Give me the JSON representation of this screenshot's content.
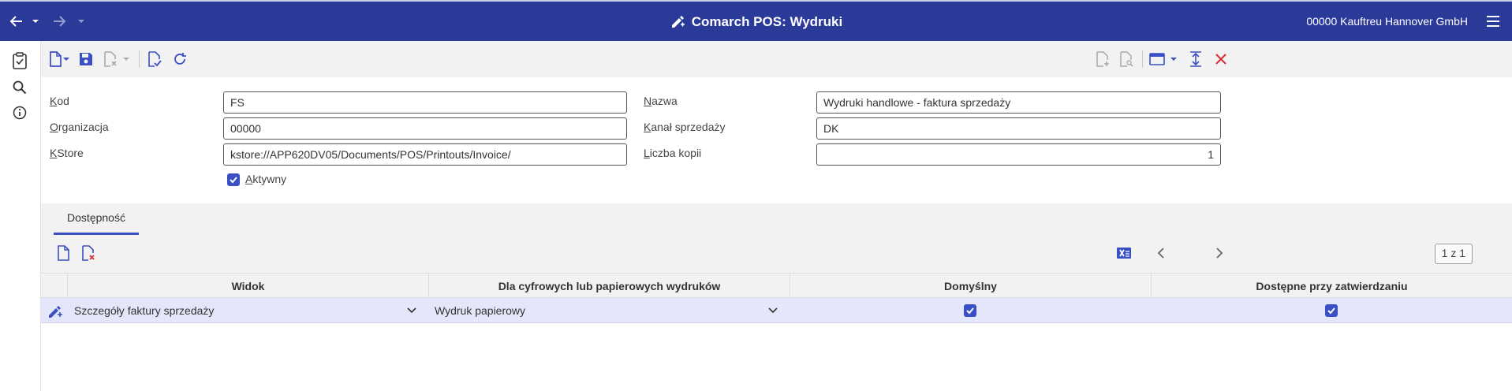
{
  "app": {
    "title": "Comarch POS: Wydruki",
    "company": "00000  Kauftreu Hannover GmbH",
    "icons": {
      "back": "arrow-left-icon",
      "forward": "arrow-right-icon",
      "title": "edit-pencil-icon",
      "menu": "hamburger-menu-icon"
    }
  },
  "rail": [
    {
      "name": "clipboard-check-icon"
    },
    {
      "name": "search-icon"
    },
    {
      "name": "info-icon"
    }
  ],
  "form": {
    "kod": {
      "label": "Kod",
      "value": "FS"
    },
    "nazwa": {
      "label": "Nazwa",
      "value": "Wydruki handlowe - faktura sprzedaży"
    },
    "organizacja": {
      "label": "Organizacja",
      "value": "00000"
    },
    "kanal": {
      "label": "Kanał sprzedaży",
      "value": "DK"
    },
    "kstore": {
      "label": "KStore",
      "value": "kstore://APP620DV05/Documents/POS/Printouts/Invoice/"
    },
    "kopie": {
      "label": "Liczba kopii",
      "value": "1"
    },
    "aktywny": {
      "label": "Aktywny",
      "checked": true
    }
  },
  "tabs": [
    {
      "label": "Dostępność",
      "active": true
    }
  ],
  "grid": {
    "pager": "1 z 1",
    "columns": [
      "Widok",
      "Dla cyfrowych lub papierowych wydruków",
      "Domyślny",
      "Dostępne przy zatwierdzaniu"
    ],
    "rows": [
      {
        "widok": "Szczegóły faktury sprzedaży",
        "typ": "Wydruk papierowy",
        "domyslny": true,
        "dostepne": true
      }
    ]
  },
  "colors": {
    "topbar": "#2b3a99",
    "accent": "#3b4fc4",
    "selected_row": "#e4e6f9",
    "close": "#d32f2f"
  }
}
